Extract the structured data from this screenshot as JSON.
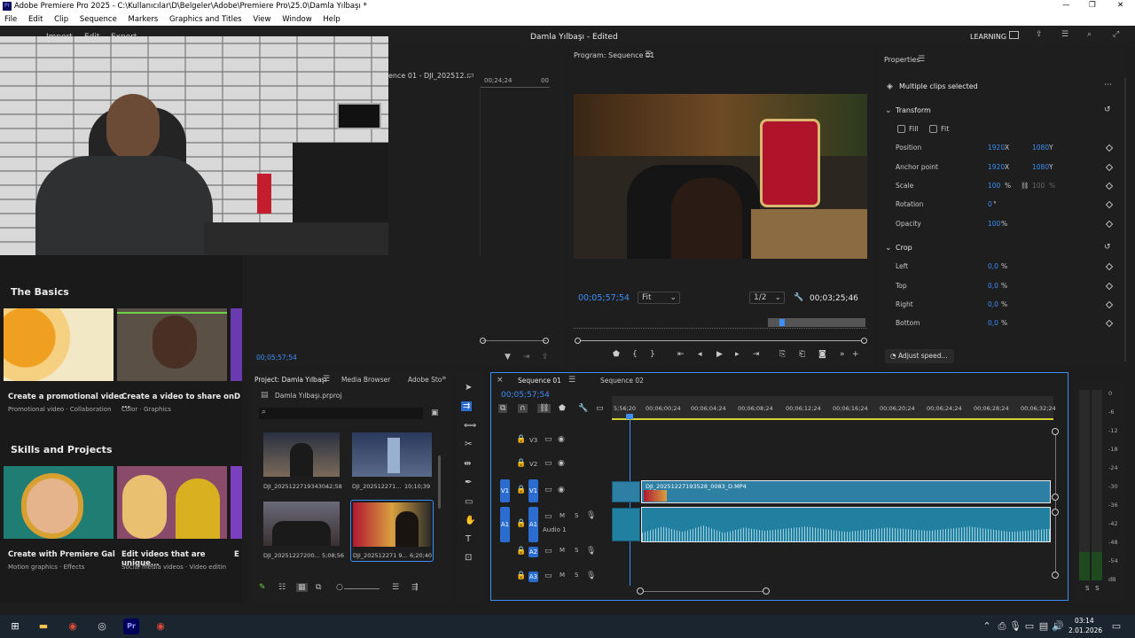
{
  "window": {
    "title": "Adobe Premiere Pro 2025 - C:\\Kullanıcılar\\D\\Belgeler\\Adobe\\Premiere Pro\\25.0\\Damla Yılbaşı *",
    "min": "—",
    "max": "❐",
    "close": "✕"
  },
  "menu": [
    "File",
    "Edit",
    "Clip",
    "Sequence",
    "Markers",
    "Graphics and Titles",
    "View",
    "Window",
    "Help"
  ],
  "header": {
    "project_title": "Damla Yılbaşı - Edited",
    "tabs": [
      "Import",
      "Edit",
      "Export"
    ],
    "learning": "LEARNING"
  },
  "source": {
    "tab": "ence 01 - DJI_202512...",
    "time": "00;24;24",
    "time2": "00",
    "bottom_time": "00;05;57;54"
  },
  "program": {
    "title": "Program: Sequence 01",
    "timecode": "00;05;57;54",
    "fit": "Fit",
    "ratio": "1/2",
    "duration": "00;03;25;46"
  },
  "properties": {
    "title": "Properties",
    "selection": "Multiple clips selected",
    "transform": "Transform",
    "fill": "Fill",
    "fit": "Fit",
    "rows": [
      {
        "label": "Position",
        "v1": "1920",
        "u1": "X",
        "v2": "1080",
        "u2": "Y"
      },
      {
        "label": "Anchor point",
        "v1": "1920",
        "u1": "X",
        "v2": "1080",
        "u2": "Y"
      },
      {
        "label": "Scale",
        "v1": "100",
        "u1": "%",
        "v2": "100",
        "u2": "%"
      },
      {
        "label": "Rotation",
        "v1": "0",
        "u1": "°",
        "v2": "",
        "u2": ""
      },
      {
        "label": "Opacity",
        "v1": "100",
        "u1": "%",
        "v2": "",
        "u2": ""
      }
    ],
    "crop": "Crop",
    "crop_rows": [
      {
        "label": "Left",
        "v": "0,0",
        "u": "%"
      },
      {
        "label": "Top",
        "v": "0,0",
        "u": "%"
      },
      {
        "label": "Right",
        "v": "0,0",
        "u": "%"
      },
      {
        "label": "Bottom",
        "v": "0,0",
        "u": "%"
      }
    ],
    "adjust": "Adjust speed..."
  },
  "learn": {
    "basics": "The Basics",
    "cards1": [
      {
        "title": "Create a promotional video",
        "sub": "Promotional video · Collaboration"
      },
      {
        "title": "Create a video to share on ...",
        "sub": "Color · Graphics"
      },
      {
        "title": "D",
        "sub": ""
      }
    ],
    "skills": "Skills and Projects",
    "cards2": [
      {
        "title": "Create with Premiere Gal",
        "sub": "Motion graphics · Effects"
      },
      {
        "title": "Edit videos that are unique...",
        "sub": "Social media videos · Video editin"
      },
      {
        "title": "E",
        "sub": ""
      }
    ]
  },
  "project": {
    "tabs": [
      "Project: Damla Yılbaşı",
      "Media Browser",
      "Adobe Sto"
    ],
    "file": "Damla Yılbaşı.prproj",
    "items": [
      {
        "name": "DJI_20251227193430...",
        "dur": "42;58"
      },
      {
        "name": "DJI_202512271...",
        "dur": "10;10;39"
      },
      {
        "name": "DJI_20251227200...",
        "dur": "5;08;56"
      },
      {
        "name": "DJI_202512271 9...",
        "dur": "6;20;40"
      }
    ]
  },
  "timeline": {
    "tabs": [
      "Sequence 01",
      "Sequence 02"
    ],
    "timecode": "00;05;57;54",
    "ruler": [
      "5;56;20",
      "00;06;00;24",
      "00;06;04;24",
      "00;06;08;24",
      "00;06;12;24",
      "00;06;16;24",
      "00;06;20;24",
      "00;06;24;24",
      "00;06;28;24",
      "00;06;32;24"
    ],
    "tracks": [
      "V3",
      "V2",
      "V1",
      "A1",
      "A2",
      "A3"
    ],
    "audio_name": "Audio 1",
    "clip_name": "DJI_20251227193528_0083_D.MP4"
  },
  "meter": {
    "labels": [
      "0",
      "-6",
      "-12",
      "-18",
      "-24",
      "-30",
      "-36",
      "-42",
      "-48",
      "-54",
      "dB"
    ],
    "ss": "S   S"
  },
  "taskbar": {
    "time": "03:14",
    "date": "2.01.2026"
  },
  "colors": {
    "accent": "#3e8ef7",
    "clip": "#2d7fa3",
    "audio": "#217fa0",
    "track": "#2a6cd0"
  }
}
